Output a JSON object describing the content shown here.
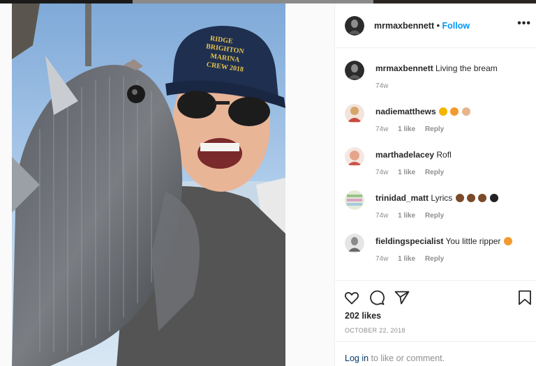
{
  "post": {
    "username": "mrmaxbennett",
    "dot": "•",
    "follow_label": "Follow",
    "more_label": "•••",
    "photo_alt": ""
  },
  "comments": [
    {
      "user": "mrmaxbennett",
      "text": "Living the bream",
      "age": "74w",
      "likes": "",
      "reply": "",
      "emojis": [],
      "avatar": "#2b2b2b"
    },
    {
      "user": "nadiematthews",
      "text": "",
      "age": "74w",
      "likes": "1 like",
      "reply": "Reply",
      "emojis": [
        "#f5b400",
        "#f39a2f",
        "#e9b48a"
      ],
      "avatar": "#c94a3d"
    },
    {
      "user": "marthadelacey",
      "text": "Rofl",
      "age": "74w",
      "likes": "1 like",
      "reply": "Reply",
      "emojis": [],
      "avatar": "#e6a58b"
    },
    {
      "user": "trinidad_matt",
      "text": "Lyrics",
      "age": "74w",
      "likes": "1 like",
      "reply": "Reply",
      "emojis": [
        "#7a4a2a",
        "#7a4a2a",
        "#7a4a2a",
        "#222222"
      ],
      "avatar": "#9bc28a"
    },
    {
      "user": "fieldingspecialist",
      "text": "You little ripper",
      "age": "74w",
      "likes": "1 like",
      "reply": "Reply",
      "emojis": [
        "#f39a2f"
      ],
      "avatar": "#8a8a8a"
    }
  ],
  "footer": {
    "likes": "202 likes",
    "date": "OCTOBER 22, 2018",
    "login_link": "Log in",
    "login_rest": " to like or comment."
  },
  "icons": {
    "like": "heart-icon",
    "comment": "comment-bubble-icon",
    "share": "paper-plane-icon",
    "save": "bookmark-icon",
    "more": "more-dots-icon"
  },
  "colors": {
    "link_blue": "#0095f6",
    "meta_gray": "#8e8e8e",
    "border": "#efefef"
  }
}
